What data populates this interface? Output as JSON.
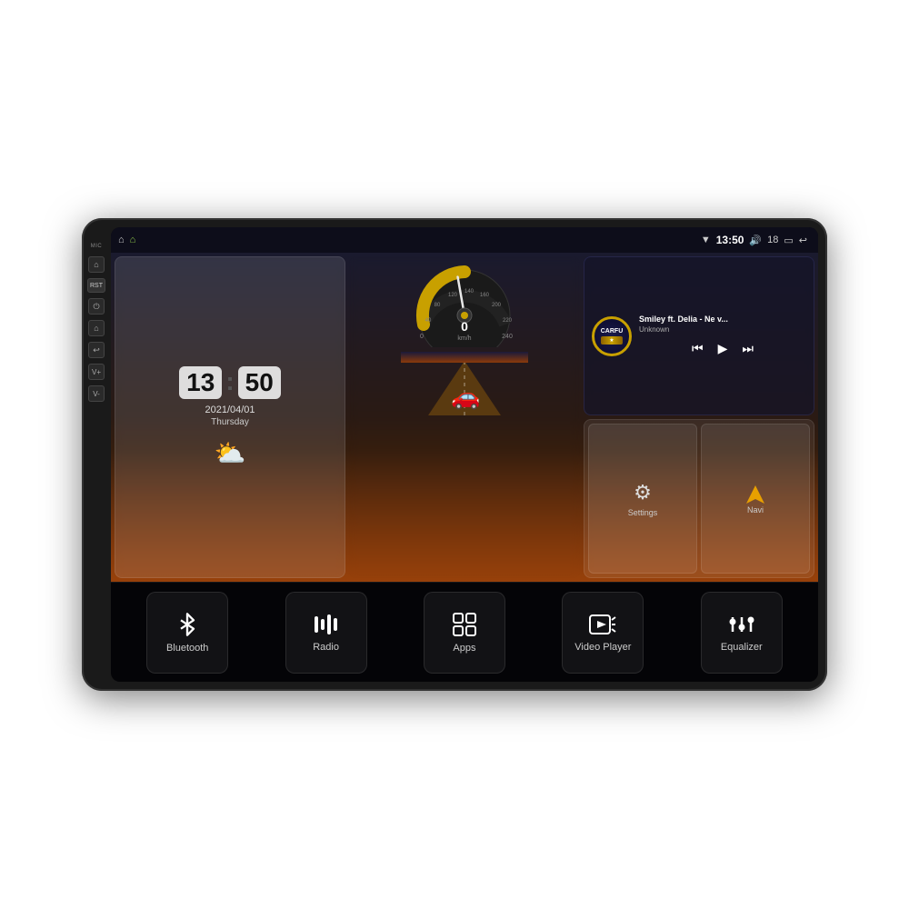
{
  "device": {
    "status_bar": {
      "wifi_icon": "▼",
      "time": "13:50",
      "volume_icon": "🔊",
      "volume_level": "18",
      "battery_icon": "▭",
      "back_icon": "↩"
    },
    "side_buttons": [
      {
        "id": "home",
        "label": "⌂"
      },
      {
        "id": "rst",
        "label": "RST"
      },
      {
        "id": "power",
        "label": "⏻"
      },
      {
        "id": "home2",
        "label": "⌂"
      },
      {
        "id": "back",
        "label": "↩"
      },
      {
        "id": "vol_up",
        "label": "V+"
      },
      {
        "id": "vol_down",
        "label": "V-"
      }
    ],
    "mic_label": "MIC"
  },
  "clock_widget": {
    "time": "13:50",
    "time_h": "13",
    "time_m": "50",
    "date": "2021/04/01",
    "day": "Thursday",
    "weather": "⛅"
  },
  "music_widget": {
    "title": "Smiley ft. Delia - Ne v...",
    "artist": "Unknown",
    "prev_label": "⏮",
    "play_label": "▶",
    "next_label": "⏭",
    "logo_text": "CARFU",
    "ribbon_text": "★★★★★"
  },
  "settings_widget": {
    "settings_label": "Settings",
    "navi_label": "Navi"
  },
  "bottom_bar": {
    "items": [
      {
        "id": "bluetooth",
        "label": "Bluetooth",
        "icon": "bluetooth"
      },
      {
        "id": "radio",
        "label": "Radio",
        "icon": "radio"
      },
      {
        "id": "apps",
        "label": "Apps",
        "icon": "apps"
      },
      {
        "id": "video_player",
        "label": "Video Player",
        "icon": "video"
      },
      {
        "id": "equalizer",
        "label": "Equalizer",
        "icon": "eq"
      }
    ]
  }
}
